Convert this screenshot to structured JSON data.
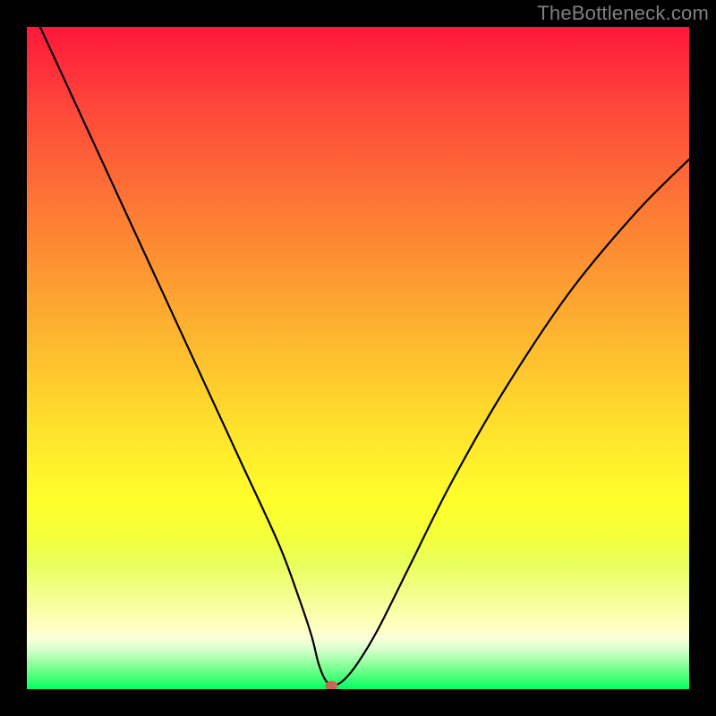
{
  "watermark": "TheBottleneck.com",
  "chart_data": {
    "type": "line",
    "title": "",
    "xlabel": "",
    "ylabel": "",
    "xlim": [
      0,
      100
    ],
    "ylim": [
      0,
      100
    ],
    "grid": false,
    "legend": false,
    "series": [
      {
        "name": "curve",
        "x": [
          2,
          8,
          14,
          20,
          26,
          32,
          38,
          41,
          43,
          44,
          45,
          46,
          46.5,
          48,
          50,
          53,
          58,
          64,
          72,
          82,
          92,
          100
        ],
        "y": [
          100,
          87,
          74,
          61,
          48,
          35,
          22,
          14,
          8,
          4,
          1.5,
          0.5,
          0.5,
          1.5,
          4,
          9,
          19,
          31,
          45,
          60,
          72,
          80
        ]
      }
    ],
    "marker": {
      "x": 46,
      "y": 0.5,
      "color": "#c26a58"
    },
    "gradient": {
      "top_color": "#fe183b",
      "mid_color": "#ffff2b",
      "bottom_color": "#00ff63"
    }
  }
}
